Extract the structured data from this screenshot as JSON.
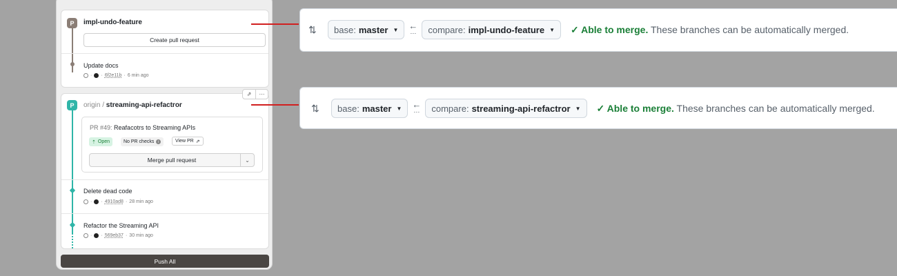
{
  "branch_list": {
    "local_branch": {
      "badge": "P",
      "name": "impl-undo-feature",
      "create_pr_label": "Create pull request",
      "commits": [
        {
          "title": "Update docs",
          "sha": "6f2e11b",
          "age": "6 min ago"
        }
      ]
    },
    "remote_branch": {
      "badge": "P",
      "origin": "origin /",
      "name": "streaming-api-refactror",
      "pull_request": {
        "number": "PR #49:",
        "title": "Reafacotrs to Streaming APIs",
        "status": "Open",
        "checks": "No PR checks",
        "view_label": "View PR",
        "merge_label": "Merge pull request"
      },
      "commits": [
        {
          "title": "Delete dead code",
          "sha": "4910ad8",
          "age": "28 min ago"
        },
        {
          "title": "Refactor the Streaming API",
          "sha": "569eb37",
          "age": "30 min ago"
        }
      ]
    },
    "push_all_label": "Push All",
    "colors": {
      "local": "#8b7e76",
      "remote": "#2fb5a8",
      "connector": "#d11f1f"
    }
  },
  "compare_bars": [
    {
      "base_label": "base:",
      "base_value": "master",
      "compare_label": "compare:",
      "compare_value": "impl-undo-feature",
      "status_ok": "✓ Able to merge.",
      "status_text": "These branches can be automatically merged."
    },
    {
      "base_label": "base:",
      "base_value": "master",
      "compare_label": "compare:",
      "compare_value": "streaming-api-refactror",
      "status_ok": "✓ Able to merge.",
      "status_text": "These branches can be automatically merged."
    }
  ],
  "icons": {
    "compare": "compare-icon",
    "arrow_left": "arrow-left-icon",
    "caret_down": "caret-down-icon",
    "check": "check-icon",
    "pr_open": "pr-open-icon",
    "external_link": "external-link-icon",
    "more": "more-icon"
  }
}
